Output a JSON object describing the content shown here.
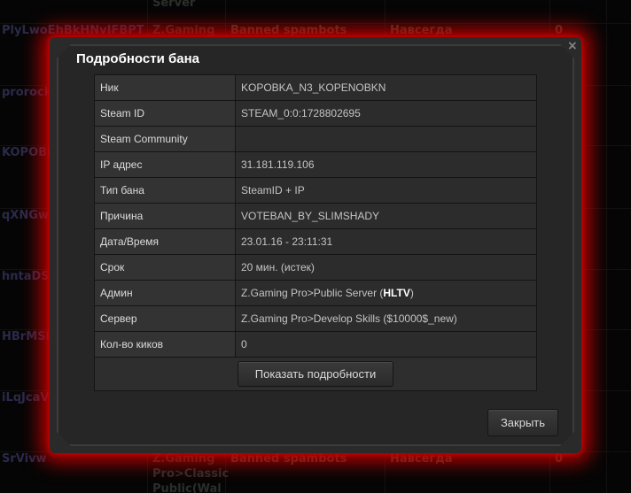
{
  "background_rows": [
    {
      "c1": "",
      "c2": "Server",
      "c3": "",
      "c4": "",
      "c5": ""
    },
    {
      "c1": "PlyLwoEhBkHNvIFBPT",
      "c2": "Z.Gaming",
      "c3": "Banned spambots",
      "c4": "Навсегда",
      "c5": "0"
    },
    {
      "c1": "prorock",
      "c2": "",
      "c3": "",
      "c4": "",
      "c5": ""
    },
    {
      "c1": "KOPOBI",
      "c2": "",
      "c3": "",
      "c4": "",
      "c5": ""
    },
    {
      "c1": "qXNGw",
      "c2": "",
      "c3": "",
      "c4": "",
      "c5": ""
    },
    {
      "c1": "hntaDSh",
      "c2": "",
      "c3": "",
      "c4": "",
      "c5": ""
    },
    {
      "c1": "HBrMSk",
      "c2": "",
      "c3": "",
      "c4": "",
      "c5": ""
    },
    {
      "c1": "iLqJcaV",
      "c2": "",
      "c3": "",
      "c4": "",
      "c5": ""
    },
    {
      "c1": "SrVivw",
      "c2": "Z.Gaming",
      "c3": "Banned spambots",
      "c4": "Навсегда",
      "c5": "0"
    },
    {
      "c1": "",
      "c2": "Pro>Classic",
      "c3": "",
      "c4": "",
      "c5": ""
    },
    {
      "c1": "",
      "c2": "Public(Wal",
      "c3": "",
      "c4": "",
      "c5": ""
    }
  ],
  "modal": {
    "close_glyph": "×",
    "title": "Подробности бана",
    "rows": [
      {
        "key": "Ник",
        "value": "KOPOBKA_N3_KOPENOBKN"
      },
      {
        "key": "Steam ID",
        "value": "STEAM_0:0:1728802695"
      },
      {
        "key": "Steam Community",
        "value": ""
      },
      {
        "key": "IP адрес",
        "value": "31.181.119.106"
      },
      {
        "key": "Тип бана",
        "value": "SteamID + IP"
      },
      {
        "key": "Причина",
        "value": "VOTEBAN_BY_SLIMSHADY"
      },
      {
        "key": "Дата/Время",
        "value": "23.01.16 - 23:11:31"
      },
      {
        "key": "Срок",
        "value": "20 мин. (истек)"
      },
      {
        "key": "Админ",
        "value_prefix": "Z.Gaming Pro>Public Server (",
        "value_bold": "HLTV",
        "value_suffix": ")"
      },
      {
        "key": "Сервер",
        "value": "Z.Gaming Pro>Develop Skills ($10000$_new)"
      },
      {
        "key": "Кол-во киков",
        "value": "0"
      }
    ],
    "show_details_label": "Показать подробности",
    "close_label": "Закрыть"
  }
}
